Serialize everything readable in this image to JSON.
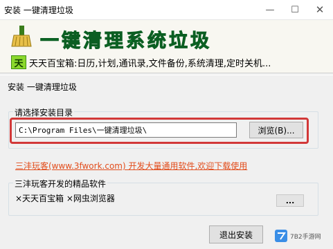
{
  "window": {
    "title": "安装 一键清理垃圾"
  },
  "banner": {
    "app_name": "一键清理系统垃圾",
    "icon_char": "天",
    "features": "天天百宝箱:日历,计划,通讯录,文件备份,系统清理,定时关机..."
  },
  "content": {
    "install_label": "安装 一键清理垃圾",
    "dir_group_title": "请选择安装目录",
    "dir_value": "C:\\Program Files\\一键清理垃圾\\",
    "browse_label": "浏览(B)...",
    "promo_text": "三沣玩客(www.3fwork.com) 开发大量通用软件,欢迎下载使用",
    "products_group_title": "三沣玩客开发的精品软件",
    "products_text": "×天天百宝箱 ×网虫浏览器",
    "more_label": "...",
    "exit_label": "退出安装"
  },
  "watermark": {
    "text": "7B2手游网"
  },
  "colors": {
    "title_green": "#1aa23e",
    "highlight_red": "#d23838",
    "promo_orange": "#e24c1b"
  },
  "icons": [
    "broom-icon",
    "minimize-icon",
    "maximize-icon",
    "close-icon"
  ]
}
